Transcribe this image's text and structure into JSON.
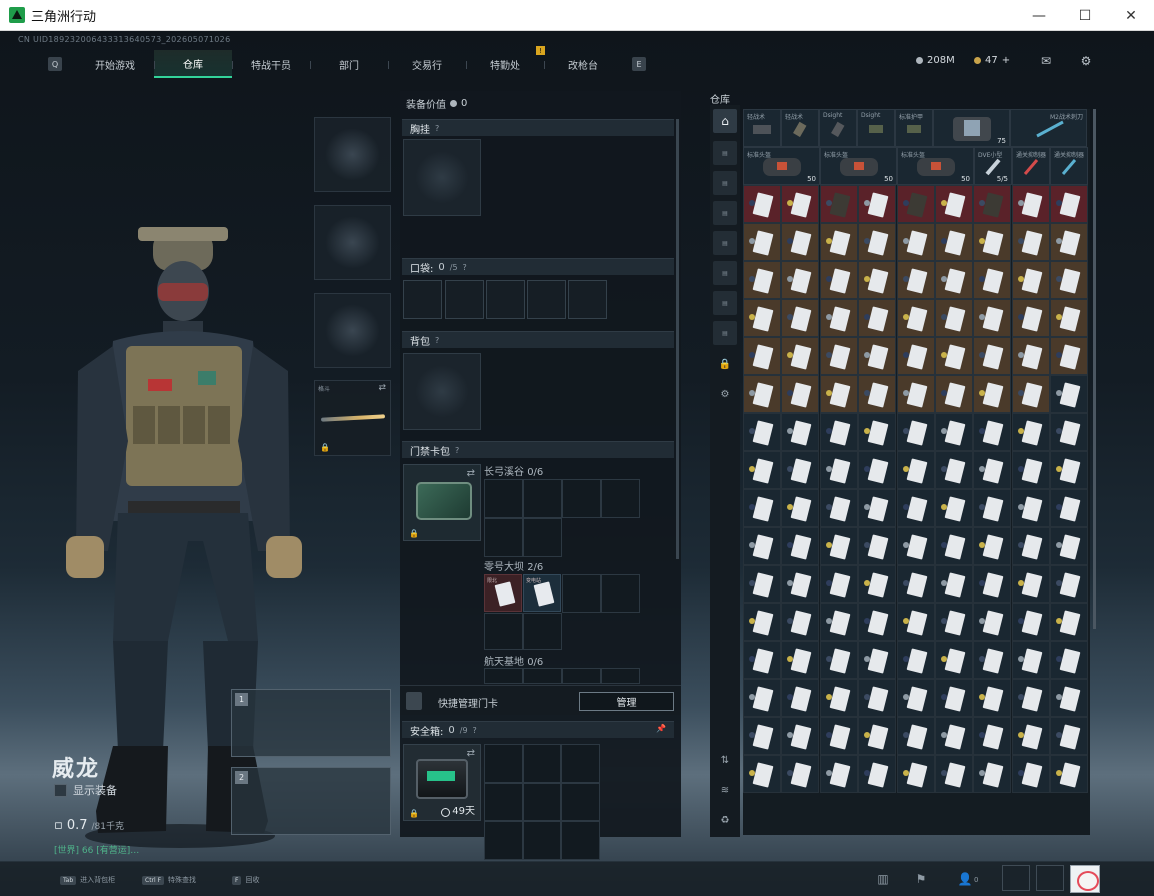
{
  "window": {
    "title": "三角洲行动",
    "controls": [
      "—",
      "☐",
      "✕"
    ]
  },
  "uid_text": "CN UID189232006433313640573_202605071026",
  "nav": {
    "left_key": "Q",
    "right_key": "E",
    "tabs": [
      {
        "label": "开始游戏",
        "active": false
      },
      {
        "label": "仓库",
        "active": true
      },
      {
        "label": "特战干员",
        "active": false
      },
      {
        "label": "部门",
        "active": false
      },
      {
        "label": "交易行",
        "active": false
      },
      {
        "label": "特勤处",
        "active": false,
        "badge": "!"
      },
      {
        "label": "改枪台",
        "active": false
      }
    ]
  },
  "currency": {
    "silver": "208M",
    "gold": "47",
    "gold_plus": "+"
  },
  "operator": {
    "name": "威龙",
    "show_gear_label": "显示装备",
    "armor_value": "0.7",
    "armor_max": "/81千克",
    "world_chat": "[世界] 66 [有营运]…"
  },
  "weapon_slot": {
    "label": "格斗"
  },
  "gun_slots": [
    "1",
    "2"
  ],
  "loadout": {
    "value_label": "装备价值",
    "value": "0",
    "chest_rig": "胸挂",
    "pocket_label": "口袋:",
    "pocket_value": "0",
    "pocket_max": "/5",
    "backpack": "背包",
    "keycard_bag": "门禁卡包",
    "maps": [
      {
        "name": "长弓溪谷",
        "count": "0/6"
      },
      {
        "name": "零号大坝",
        "count": "2/6"
      },
      {
        "name": "航天基地",
        "count": "0/6"
      }
    ],
    "mini_cards": [
      "限北",
      "变电站"
    ],
    "quick_manage": "快捷管理门卡",
    "manage_button": "管理",
    "safebox_label": "安全箱:",
    "safebox_value": "0",
    "safebox_max": "/9",
    "safebox_days": "49天",
    "help": "?"
  },
  "warehouse": {
    "label": "仓库",
    "equip_row1": [
      {
        "label": "轻战术"
      },
      {
        "label": "轻战术"
      },
      {
        "label": "Dsight"
      },
      {
        "label": "Dsight"
      },
      {
        "label": "标准护甲"
      },
      {
        "label": "",
        "count": "75"
      },
      {
        "label": "M2战术刺刀"
      }
    ],
    "equip_row2": [
      {
        "label": "标准头盔",
        "count": "50"
      },
      {
        "label": "标准头盔",
        "count": "50"
      },
      {
        "label": "标准头盔",
        "count": "50"
      },
      {
        "label": "DVE小型",
        "count": "5/5"
      },
      {
        "label": "通关抑制器"
      },
      {
        "label": "通关抑制器"
      }
    ]
  },
  "bottom_bar": {
    "hints": [
      {
        "key": "Tab",
        "text": "进入背包柜"
      },
      {
        "key": "Ctrl F",
        "text": "特殊查找"
      },
      {
        "key": "F",
        "text": "回收"
      }
    ],
    "friends_count": "0"
  },
  "colors": {
    "accent_green": "#33d39a",
    "gold": "#c9a44b",
    "warehouse_red_row": "#5a2229",
    "warehouse_brown_row": "#4a3a2a"
  }
}
